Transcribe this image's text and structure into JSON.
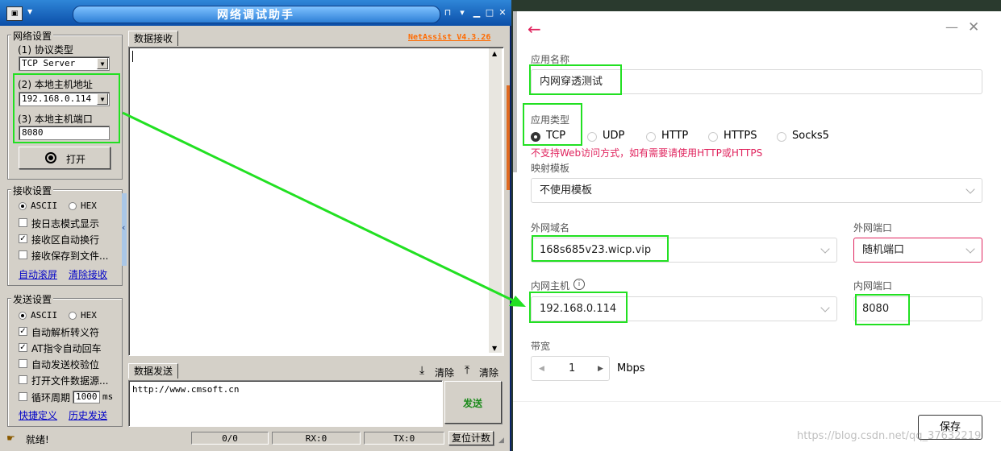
{
  "netassist": {
    "title": "网络调试助手",
    "brand": "NetAssist V4.3.26",
    "sysmenu_icon": "computer-icon",
    "window_buttons": [
      "pin-icon",
      "minimize-icon",
      "maximize-icon",
      "close-icon"
    ],
    "net_settings": {
      "group_label": "网络设置",
      "protocol_label": "(1) 协议类型",
      "protocol_value": "TCP Server",
      "host_label": "(2) 本地主机地址",
      "host_value": "192.168.0.114",
      "port_label": "(3) 本地主机端口",
      "port_value": "8080",
      "open_button": "打开"
    },
    "recv_settings": {
      "group_label": "接收设置",
      "ascii": "ASCII",
      "hex": "HEX",
      "options": [
        {
          "label": "按日志模式显示",
          "checked": false
        },
        {
          "label": "接收区自动换行",
          "checked": true
        },
        {
          "label": "接收保存到文件...",
          "checked": false
        }
      ],
      "links": [
        "自动滚屏",
        "清除接收"
      ]
    },
    "send_settings": {
      "group_label": "发送设置",
      "ascii": "ASCII",
      "hex": "HEX",
      "options": [
        {
          "label": "自动解析转义符",
          "checked": true
        },
        {
          "label": "AT指令自动回车",
          "checked": true
        },
        {
          "label": "自动发送校验位",
          "checked": false
        },
        {
          "label": "打开文件数据源...",
          "checked": false
        }
      ],
      "cycle_label": "循环周期",
      "cycle_value": "1000",
      "cycle_unit": "ms",
      "links": [
        "快捷定义",
        "历史发送"
      ]
    },
    "recv_tab": "数据接收",
    "send_tab": "数据发送",
    "clear_1": "清除",
    "clear_2": "清除",
    "send_text": "http://www.cmsoft.cn",
    "send_button": "发送",
    "status": {
      "ready": "就绪!",
      "count": "0/0",
      "rx": "RX:0",
      "tx": "TX:0",
      "reset": "复位计数"
    }
  },
  "mapping": {
    "app_name_label": "应用名称",
    "app_name_value": "内网穿透测试",
    "app_type_label": "应用类型",
    "types": [
      {
        "label": "TCP",
        "selected": true
      },
      {
        "label": "UDP",
        "selected": false
      },
      {
        "label": "HTTP",
        "selected": false
      },
      {
        "label": "HTTPS",
        "selected": false
      },
      {
        "label": "Socks5",
        "selected": false
      }
    ],
    "warning": "不支持Web访问方式，如有需要请使用HTTP或HTTPS",
    "template_label": "映射模板",
    "template_value": "不使用模板",
    "domain_label": "外网域名",
    "domain_value": "168s685v23.wicp.vip",
    "ext_port_label": "外网端口",
    "ext_port_value": "随机端口",
    "inner_host_label": "内网主机",
    "inner_host_value": "192.168.0.114",
    "inner_port_label": "内网端口",
    "inner_port_value": "8080",
    "bandwidth_label": "带宽",
    "bandwidth_value": "1",
    "bandwidth_unit": "Mbps",
    "save_button": "保存",
    "watermark": "https://blog.csdn.net/qq_37632219",
    "colors": {
      "accent": "#e0245e",
      "highlight": "#22e022",
      "warning": "#e0245e"
    }
  }
}
